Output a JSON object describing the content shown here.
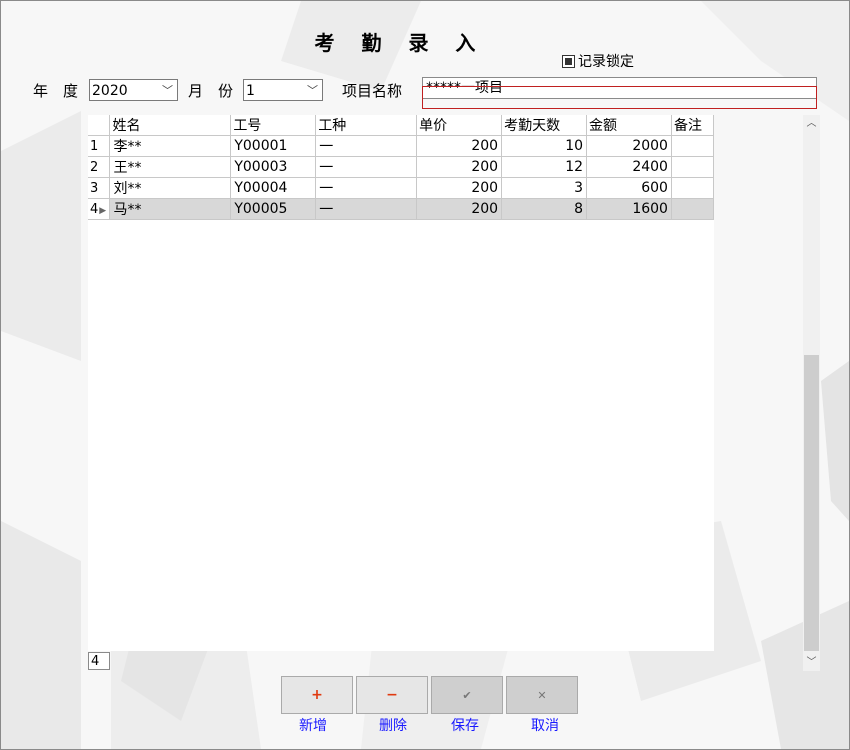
{
  "window": {
    "title": "考 勤 录 入"
  },
  "lock": {
    "label": "记录锁定",
    "checked": true
  },
  "filters": {
    "year_label": "年　度",
    "year_value": "2020",
    "month_label": "月　份",
    "month_value": "1",
    "project_label": "项目名称",
    "project_value": "*****一项目"
  },
  "table": {
    "columns": [
      "姓名",
      "工号",
      "工种",
      "单价",
      "考勤天数",
      "金额",
      "备注"
    ],
    "rows": [
      {
        "rownum": "1",
        "name": "李**",
        "id": "Y00001",
        "type": "一",
        "price": "200",
        "days": "10",
        "amount": "2000",
        "note": ""
      },
      {
        "rownum": "2",
        "name": "王**",
        "id": "Y00003",
        "type": "一",
        "price": "200",
        "days": "12",
        "amount": "2400",
        "note": ""
      },
      {
        "rownum": "3",
        "name": "刘**",
        "id": "Y00004",
        "type": "一",
        "price": "200",
        "days": "3",
        "amount": "600",
        "note": ""
      },
      {
        "rownum": "4",
        "name": "马**",
        "id": "Y00005",
        "type": "一",
        "price": "200",
        "days": "8",
        "amount": "1600",
        "note": ""
      }
    ],
    "selected_row": 3,
    "record_count": "4"
  },
  "buttons": {
    "add": {
      "icon": "+",
      "label": "新增"
    },
    "delete": {
      "icon": "−",
      "label": "删除"
    },
    "save": {
      "icon": "✔",
      "label": "保存"
    },
    "cancel": {
      "icon": "✕",
      "label": "取消"
    }
  },
  "colors": {
    "accent": "#1a1aff",
    "add_icon": "#e03a10",
    "delete_icon": "#e03a10",
    "highlight_border": "#c02020"
  }
}
